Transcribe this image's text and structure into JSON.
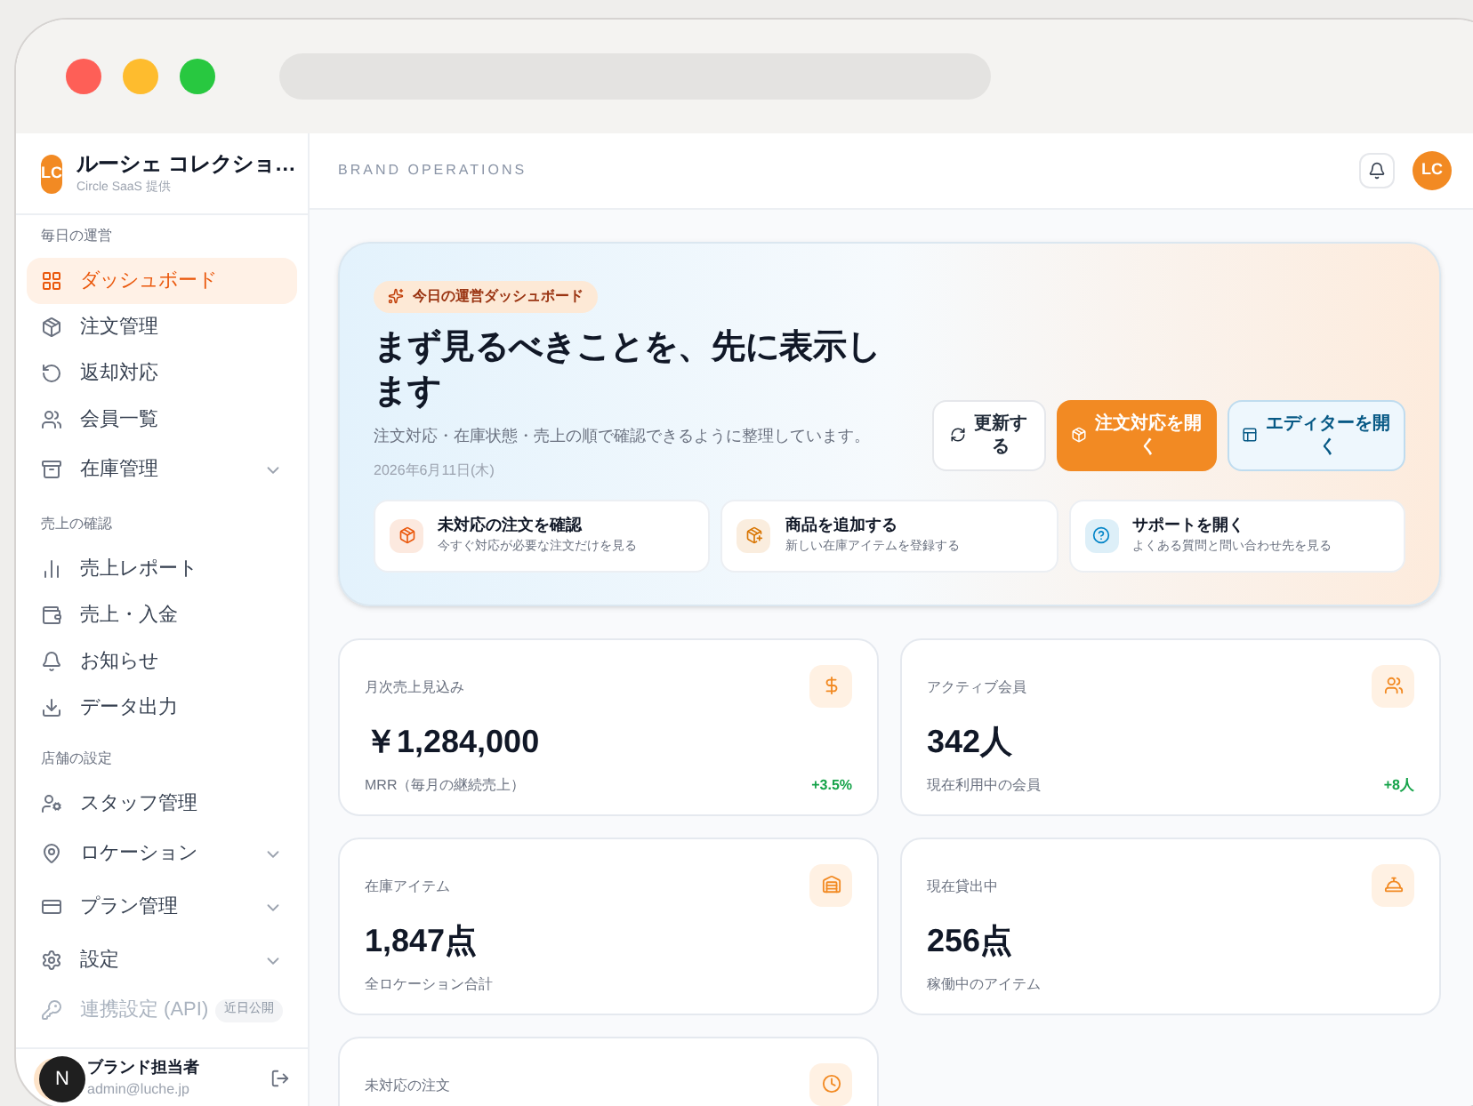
{
  "brand": {
    "initials": "LC",
    "name": "ルーシェ コレクショ…",
    "sub": "Circle SaaS 提供"
  },
  "sidebar": {
    "sections": [
      {
        "title": "毎日の運営",
        "items": [
          {
            "label": "ダッシュボード",
            "selected": true,
            "expandable": false
          },
          {
            "label": "注文管理",
            "selected": false,
            "expandable": false
          },
          {
            "label": "返却対応",
            "selected": false,
            "expandable": false
          },
          {
            "label": "会員一覧",
            "selected": false,
            "expandable": false
          },
          {
            "label": "在庫管理",
            "selected": false,
            "expandable": true
          }
        ]
      },
      {
        "title": "売上の確認",
        "items": [
          {
            "label": "売上レポート",
            "selected": false,
            "expandable": false
          },
          {
            "label": "売上・入金",
            "selected": false,
            "expandable": false
          },
          {
            "label": "お知らせ",
            "selected": false,
            "expandable": false
          },
          {
            "label": "データ出力",
            "selected": false,
            "expandable": false
          }
        ]
      },
      {
        "title": "店舗の設定",
        "items": [
          {
            "label": "スタッフ管理",
            "selected": false,
            "expandable": false
          },
          {
            "label": "ロケーション",
            "selected": false,
            "expandable": true
          },
          {
            "label": "プラン管理",
            "selected": false,
            "expandable": true
          },
          {
            "label": "設定",
            "selected": false,
            "expandable": true
          },
          {
            "label": "連携設定 (API)",
            "selected": false,
            "expandable": false,
            "disabled": true,
            "badge": "近日公開"
          }
        ]
      }
    ]
  },
  "user": {
    "name": "ブランド担当者",
    "email": "admin@luche.jp"
  },
  "dev_badge": "N",
  "header": {
    "title": "BRAND OPERATIONS",
    "avatar": "LC"
  },
  "hero": {
    "badge": "今日の運営ダッシュボード",
    "title": "まず見るべきことを、先に表示します",
    "subtitle": "注文対応・在庫状態・売上の順で確認できるように整理しています。",
    "date": "2026年6月11日(木)",
    "buttons": [
      {
        "label": "更新する",
        "kind": "secondary"
      },
      {
        "label": "注文対応を開く",
        "kind": "primary"
      },
      {
        "label": "エディターを開く",
        "kind": "outline"
      }
    ],
    "actions": [
      {
        "title": "未対応の注文を確認",
        "desc": "今すぐ対応が必要な注文だけを見る",
        "color": "#ea580c"
      },
      {
        "title": "商品を追加する",
        "desc": "新しい在庫アイテムを登録する",
        "color": "#d97706"
      },
      {
        "title": "サポートを開く",
        "desc": "よくある質問と問い合わせ先を見る",
        "color": "#0284c7"
      }
    ]
  },
  "stats": [
    {
      "label": "月次売上見込み",
      "value": "￥1,284,000",
      "note": "MRR（毎月の継続売上）",
      "delta": "+3.5%"
    },
    {
      "label": "アクティブ会員",
      "value": "342人",
      "note": "現在利用中の会員",
      "delta": "+8人"
    },
    {
      "label": "在庫アイテム",
      "value": "1,847点",
      "note": "全ロケーション合計"
    },
    {
      "label": "現在貸出中",
      "value": "256点",
      "note": "稼働中のアイテム"
    },
    {
      "label": "未対応の注文"
    }
  ]
}
